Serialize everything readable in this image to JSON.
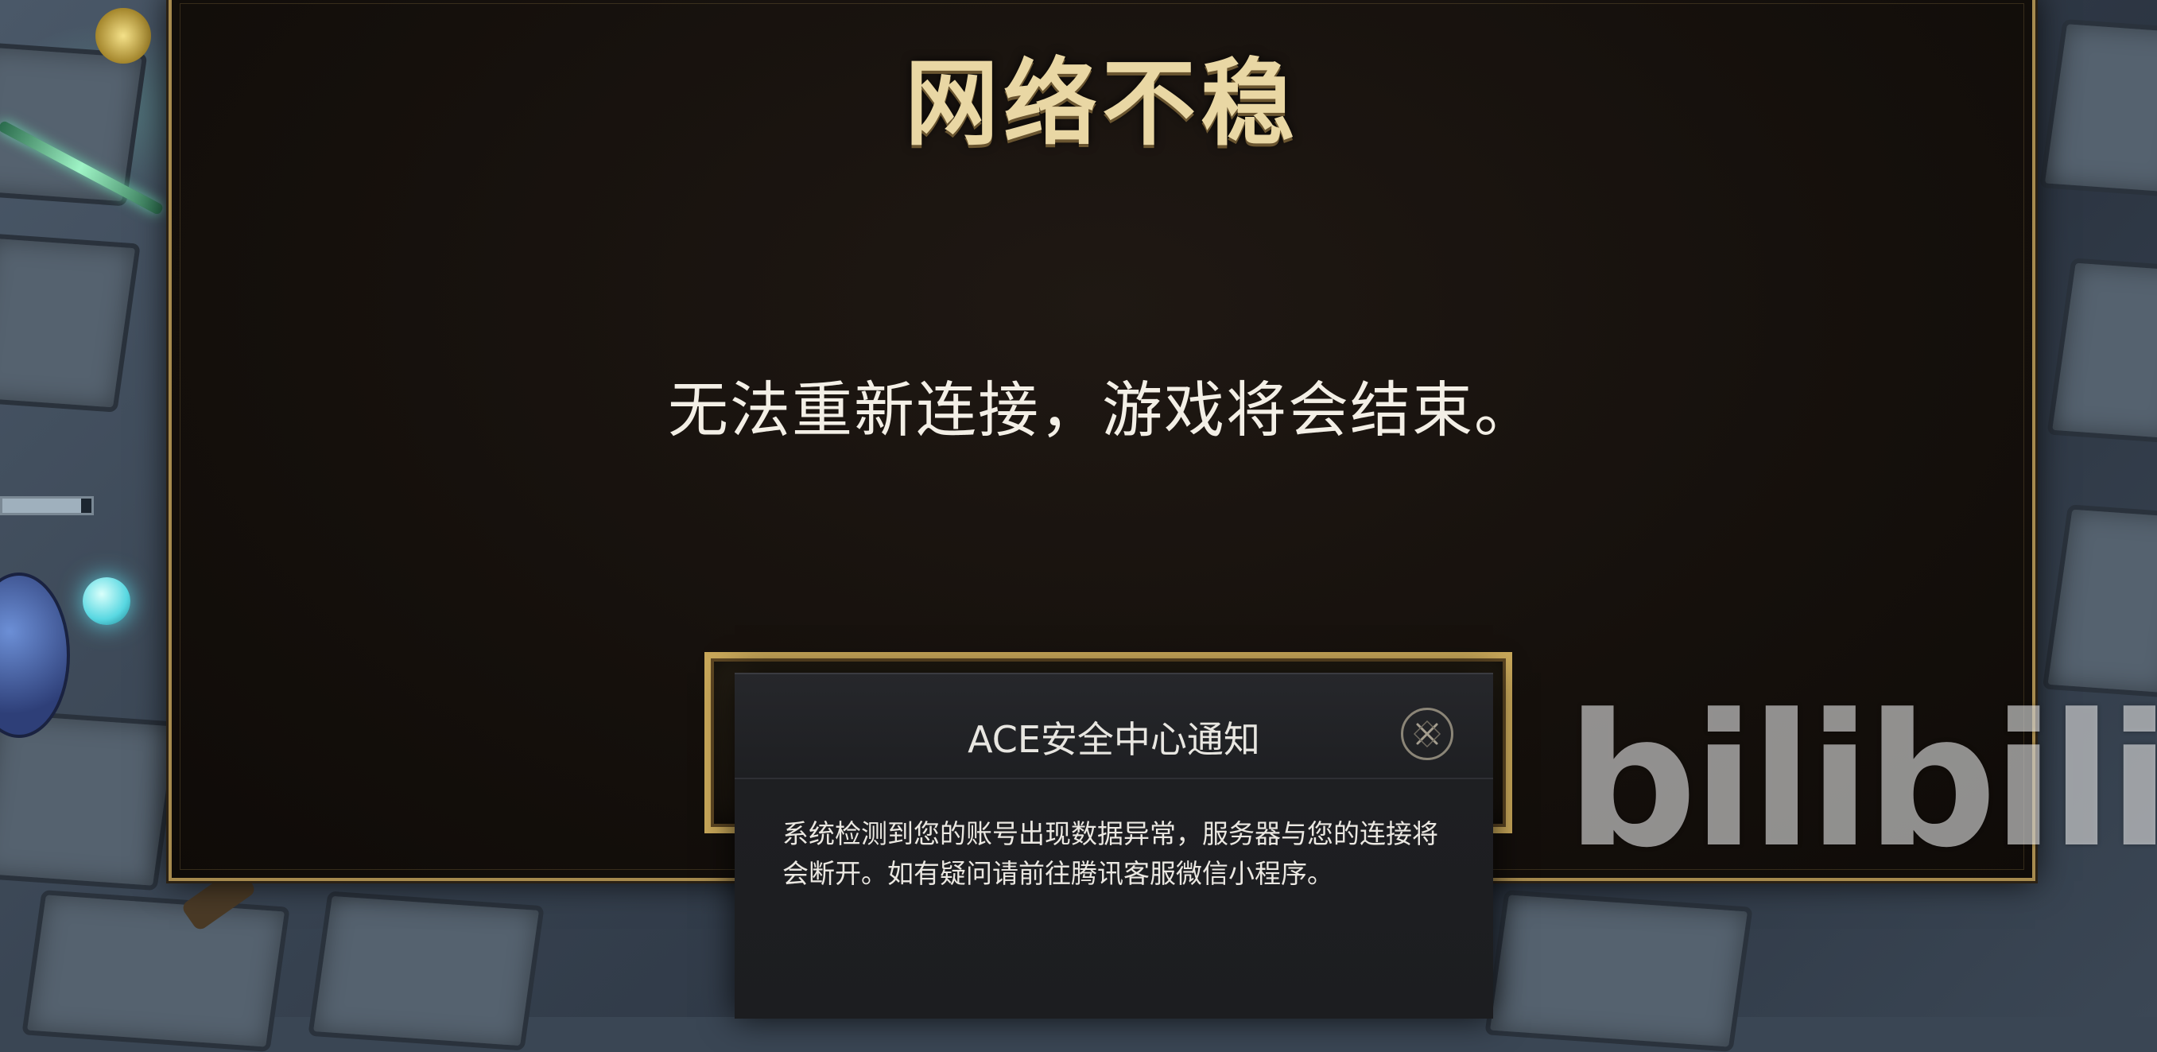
{
  "main_dialog": {
    "title": "网络不稳",
    "message": "无法重新连接，游戏将会结束。"
  },
  "ace_popup": {
    "title": "ACE安全中心通知",
    "close_icon": "close-x-circle-icon",
    "body": "系统检测到您的账号出现数据异常，服务器与您的连接将会断开。如有疑问请前往腾讯客服微信小程序。"
  },
  "watermark": {
    "text": "bilibili"
  },
  "colors": {
    "title_gold": "#e9d7a4",
    "frame_gold": "#c9a85a",
    "dialog_bg": "#15100c",
    "popup_bg": "#1e1f22"
  }
}
